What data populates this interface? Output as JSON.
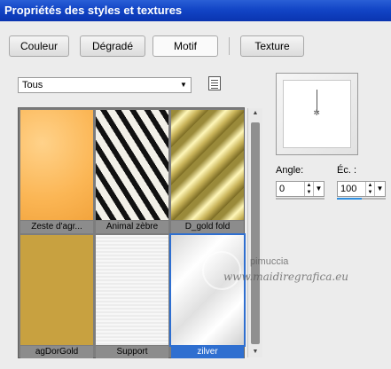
{
  "window": {
    "title": "Propriétés des styles et textures"
  },
  "tabs": [
    {
      "label": "Couleur"
    },
    {
      "label": "Dégradé"
    },
    {
      "label": "Motif"
    },
    {
      "label": "Texture"
    }
  ],
  "active_tab": "Motif",
  "category_select": {
    "value": "Tous"
  },
  "patterns": [
    {
      "name": "Zeste d'agr...",
      "swatch": "orange"
    },
    {
      "name": "Animal zèbre",
      "swatch": "zebra"
    },
    {
      "name": "D_gold fold",
      "swatch": "gold"
    },
    {
      "name": "agDorGold",
      "swatch": "goldflat"
    },
    {
      "name": "Support",
      "swatch": "support"
    },
    {
      "name": "zilver",
      "swatch": "zilver",
      "selected": true
    }
  ],
  "controls": {
    "angle_label": "Angle:",
    "angle_value": "0",
    "scale_label": "Éc. :",
    "scale_value": "100",
    "scale_level_fraction": 0.5
  },
  "watermark": {
    "line1": "pimuccia",
    "line2": "www.maidiregrafica.eu"
  },
  "colors": {
    "titlebar": "#1245c6",
    "selection": "#2f6fd0",
    "accent_bar": "#2f8fe0"
  }
}
